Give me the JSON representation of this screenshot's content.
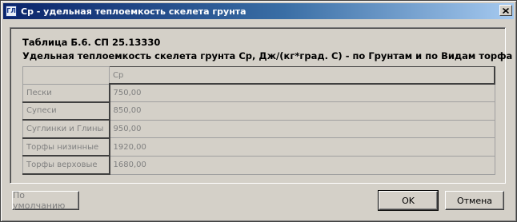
{
  "window": {
    "title": "Ср - удельная теплоемкость скелета грунта",
    "icon_text": "ГЛ"
  },
  "header": {
    "line1": "Таблица Б.6. СП 25.13330",
    "line2": "Удельная теплоемкость скелета грунта Ср, Дж/(кг*град. С) - по Грунтам и по Видам торфа"
  },
  "table": {
    "column_header": "Ср",
    "rows": [
      {
        "label": "Пески",
        "value": "750,00"
      },
      {
        "label": "Супеси",
        "value": "850,00"
      },
      {
        "label": "Суглинки и Глины",
        "value": "950,00"
      },
      {
        "label": "Торфы низинные",
        "value": "1920,00"
      },
      {
        "label": "Торфы верховые",
        "value": "1680,00"
      }
    ]
  },
  "buttons": {
    "default_label": "По умолчанию",
    "ok_label": "OK",
    "cancel_label": "Отмена"
  },
  "icons": {
    "close": "close-icon",
    "app": "app-icon"
  }
}
